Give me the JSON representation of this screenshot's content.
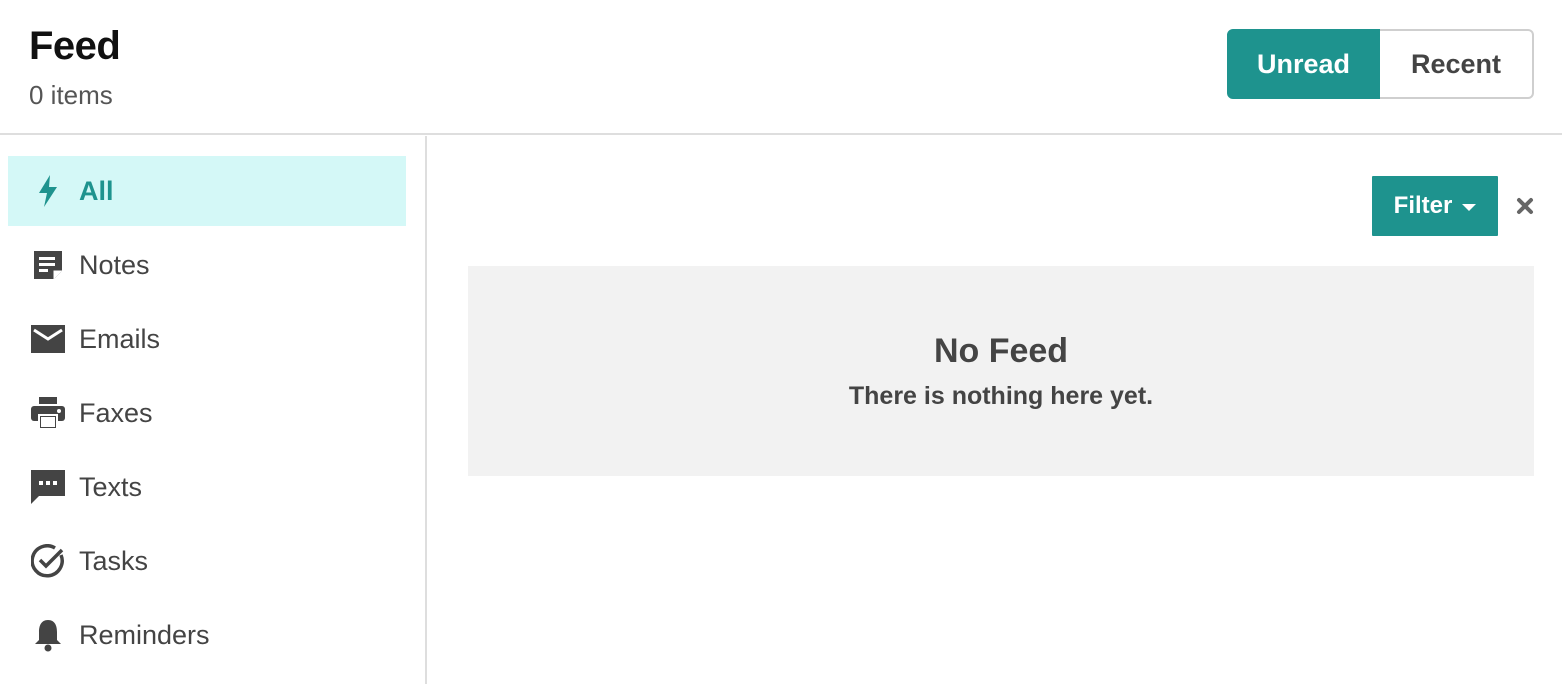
{
  "header": {
    "title": "Feed",
    "count_label": "0 items",
    "toggle": {
      "active_label": "Unread",
      "inactive_label": "Recent"
    }
  },
  "sidebar": {
    "items": [
      {
        "label": "All",
        "icon": "bolt-icon",
        "selected": true
      },
      {
        "label": "Notes",
        "icon": "note-icon",
        "selected": false
      },
      {
        "label": "Emails",
        "icon": "envelope-icon",
        "selected": false
      },
      {
        "label": "Faxes",
        "icon": "printer-icon",
        "selected": false
      },
      {
        "label": "Texts",
        "icon": "chat-bubble-icon",
        "selected": false
      },
      {
        "label": "Tasks",
        "icon": "check-circle-icon",
        "selected": false
      },
      {
        "label": "Reminders",
        "icon": "bell-icon",
        "selected": false
      }
    ]
  },
  "main": {
    "filter_label": "Filter",
    "empty_state": {
      "title": "No Feed",
      "subtitle": "There is nothing here yet."
    }
  },
  "colors": {
    "accent": "#1e938e",
    "selected_bg": "#d4f8f7",
    "icon": "#444444",
    "panel_bg": "#f2f2f2"
  }
}
